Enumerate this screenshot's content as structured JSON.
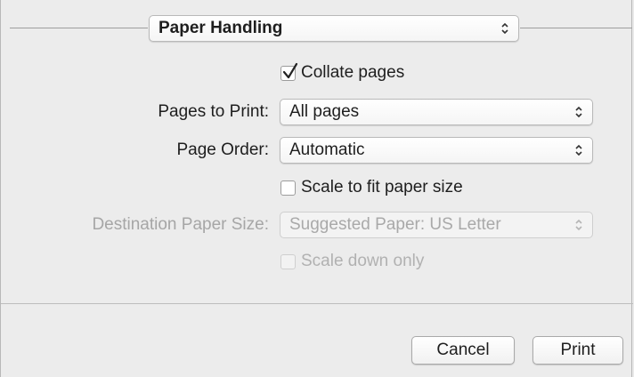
{
  "section_popup": {
    "selected": "Paper Handling"
  },
  "collate": {
    "label": "Collate pages",
    "checked": true
  },
  "pages_to_print": {
    "label": "Pages to Print:",
    "selected": "All pages"
  },
  "page_order": {
    "label": "Page Order:",
    "selected": "Automatic"
  },
  "scale_to_fit": {
    "label": "Scale to fit paper size",
    "checked": false
  },
  "destination_paper_size": {
    "label": "Destination Paper Size:",
    "selected": "Suggested Paper: US Letter",
    "enabled": false
  },
  "scale_down_only": {
    "label": "Scale down only",
    "checked": false,
    "enabled": false
  },
  "buttons": {
    "cancel": "Cancel",
    "print": "Print"
  },
  "icons": {
    "popup_arrows": "up-down-chevron-icon",
    "checkmark": "checkmark-icon"
  }
}
